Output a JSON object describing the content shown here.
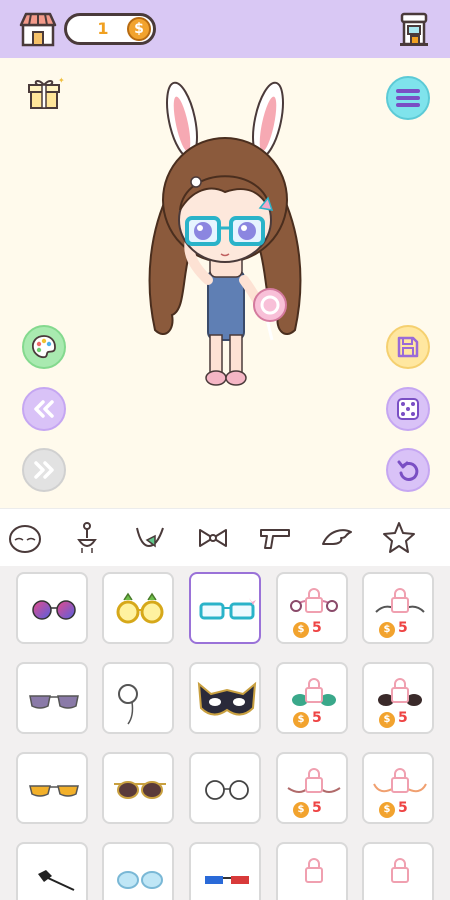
{
  "header": {
    "coins": "1",
    "coin_symbol": "$"
  },
  "categories": [
    "face-icon",
    "earring-icon",
    "necklace-icon",
    "bow-icon",
    "gun-icon",
    "wing-icon",
    "star-icon"
  ],
  "items": {
    "price_symbol": "$",
    "price": "5"
  },
  "colors": {
    "topbar": "#d9c8f4",
    "stage": "#fffaec",
    "accent": "#9a72d8",
    "coin": "#f2a32e"
  }
}
